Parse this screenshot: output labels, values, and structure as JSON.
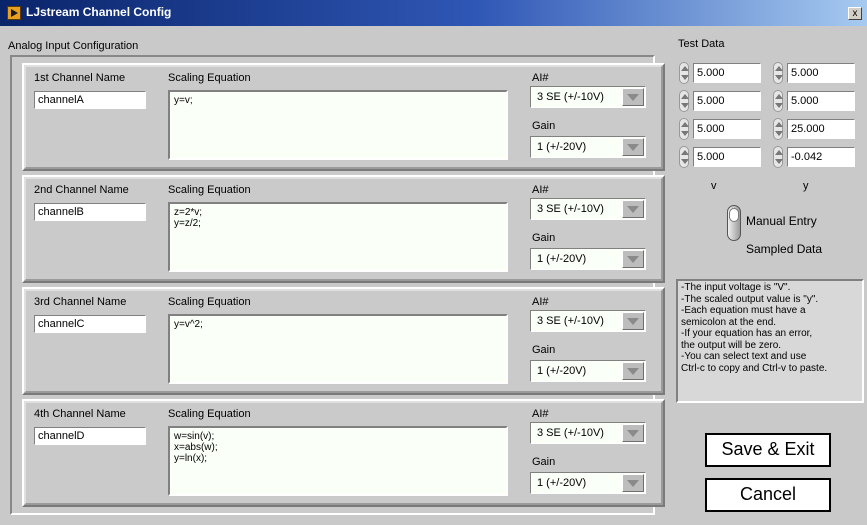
{
  "window": {
    "title": "LJstream Channel Config",
    "close_label": "x"
  },
  "analog": {
    "section_label": "Analog Input Configuration"
  },
  "channels": [
    {
      "name_label": "1st Channel Name",
      "name_value": "channelA",
      "eq_label": "Scaling Equation",
      "equation": "y=v;",
      "ai_label": "AI#",
      "ai_value": "3 SE (+/-10V)",
      "gain_label": "Gain",
      "gain_value": "1 (+/-20V)"
    },
    {
      "name_label": "2nd Channel Name",
      "name_value": "channelB",
      "eq_label": "Scaling Equation",
      "equation": "z=2*v;\ny=z/2;",
      "ai_label": "AI#",
      "ai_value": "3 SE (+/-10V)",
      "gain_label": "Gain",
      "gain_value": "1 (+/-20V)"
    },
    {
      "name_label": "3rd Channel Name",
      "name_value": "channelC",
      "eq_label": "Scaling Equation",
      "equation": "y=v^2;",
      "ai_label": "AI#",
      "ai_value": "3 SE (+/-10V)",
      "gain_label": "Gain",
      "gain_value": "1 (+/-20V)"
    },
    {
      "name_label": "4th Channel Name",
      "name_value": "channelD",
      "eq_label": "Scaling Equation",
      "equation": "w=sin(v);\nx=abs(w);\ny=ln(x);",
      "ai_label": "AI#",
      "ai_value": "3 SE (+/-10V)",
      "gain_label": "Gain",
      "gain_value": "1 (+/-20V)"
    }
  ],
  "test_data": {
    "label": "Test Data",
    "v_values": [
      "5.000",
      "5.000",
      "5.000",
      "5.000"
    ],
    "y_values": [
      "5.000",
      "5.000",
      "25.000",
      "-0.042"
    ],
    "v_label": "v",
    "y_label": "y"
  },
  "mode_toggle": {
    "top_label": "Manual Entry",
    "bottom_label": "Sampled Data"
  },
  "info": {
    "lines": [
      "-The input voltage is \"V\".",
      "-The scaled output value is \"y\".",
      "-Each equation must have a",
      "semicolon at the end.",
      "-If your equation has an error,",
      "the output will be zero.",
      "-You can select text and use",
      "Ctrl-c to copy and Ctrl-v to paste."
    ]
  },
  "buttons": {
    "save_label": "Save & Exit",
    "cancel_label": "Cancel"
  }
}
